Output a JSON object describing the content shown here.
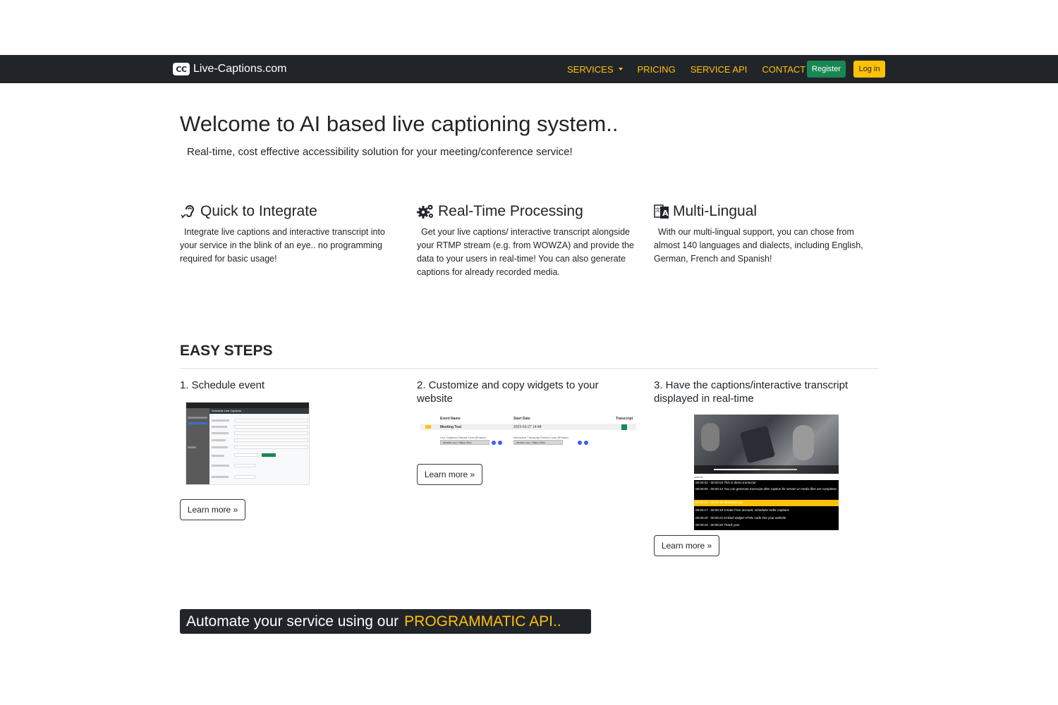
{
  "nav": {
    "brand_logo": "CC",
    "brand": "Live-Captions.com",
    "links": [
      "SERVICES",
      "PRICING",
      "SERVICE API",
      "CONTACT"
    ],
    "register": "Register",
    "login": "Log in",
    "accent_color": "#ffc107",
    "register_color": "#198754"
  },
  "hero": {
    "title": "Welcome to AI based live captioning system..",
    "subtitle": "Real-time, cost effective accessibility solution for your meeting/conference service!"
  },
  "features": [
    {
      "icon": "hearing-icon",
      "title": "Quick to Integrate",
      "text": "Integrate live captions and interactive transcript into your service in the blink of an eye.. no programming required for basic usage!"
    },
    {
      "icon": "gears-icon",
      "title": "Real-Time Processing",
      "text": "Get your live captions/ interactive transcript alongside your RTMP stream (e.g. from WOWZA) and provide the data to your users in real-time! You can also generate captions for already recorded media."
    },
    {
      "icon": "language-icon",
      "title": "Multi-Lingual",
      "text": "With our multi-lingual support, you can chose from almost 140 languages and dialects, including English, German, French and Spanish!"
    }
  ],
  "steps": {
    "heading": "EASY STEPS",
    "items": [
      {
        "title": "1. Schedule event",
        "button": "Learn more »"
      },
      {
        "title": "2. Customize and copy widgets to your website",
        "button": "Learn more »"
      },
      {
        "title": "3. Have the captions/interactive transcript displayed in real-time",
        "button": "Learn more »"
      }
    ],
    "shot1": {
      "window_title": "Schedule Live Captions"
    },
    "shot2": {
      "headers": [
        "Event Name",
        "Start Date",
        "Transcript"
      ],
      "row": {
        "name": "Meeting Test",
        "date": "2023-03-27 14:48"
      },
      "embed_labels": [
        "Live Captions Embed Code (iFrame)",
        "Interactive Transcript Embed Code (iFrame)"
      ],
      "embed_values": [
        "<iframe src=\"https://live-",
        "<iframe src=\"https://live-"
      ]
    },
    "shot3": {
      "search_label": "search...",
      "transcript": [
        "00:00:02 - 00:00:04  This is demo transcript",
        "00:00:05 - 00:00:14  You can generate transcript after caption for stream or media files are completed",
        "00:00:15 - 00:00:16  Schedule live",
        "00:00:17 - 00:00:19  Create Free account, schedule/ order captions",
        "00:00:20 - 00:00:22  Embed widget HTML code into your website",
        "00:00:24 - 00:00:26  Thank you!"
      ]
    }
  },
  "api_banner": {
    "text": "Automate your service using our",
    "highlight": "PROGRAMMATIC API.."
  }
}
